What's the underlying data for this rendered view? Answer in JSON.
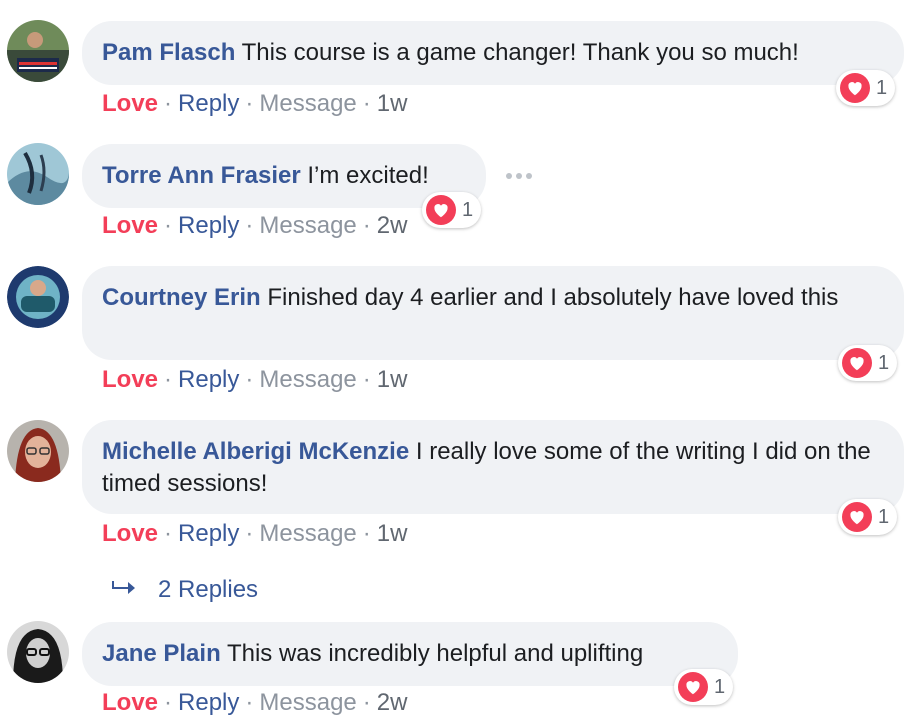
{
  "comments": [
    {
      "author": "Pam Flasch",
      "text": "This course is a game changer! Thank you so much!",
      "love": "Love",
      "reply": "Reply",
      "message": "Message",
      "age": "1w",
      "reaction_count": "1"
    },
    {
      "author": "Torre Ann Frasier",
      "text": "I’m excited!",
      "love": "Love",
      "reply": "Reply",
      "message": "Message",
      "age": "2w",
      "reaction_count": "1"
    },
    {
      "author": "Courtney Erin",
      "text": "Finished day 4 earlier and I absolutely have loved this",
      "love": "Love",
      "reply": "Reply",
      "message": "Message",
      "age": "1w",
      "reaction_count": "1"
    },
    {
      "author": "Michelle Alberigi McKenzie",
      "text": "I really love some of the writing I did on the timed sessions!",
      "love": "Love",
      "reply": "Reply",
      "message": "Message",
      "age": "1w",
      "reaction_count": "1"
    },
    {
      "author": "Jane Plain",
      "text": "This was incredibly helpful and uplifting",
      "love": "Love",
      "reply": "Reply",
      "message": "Message",
      "age": "2w",
      "reaction_count": "1"
    }
  ],
  "replies_link": {
    "label": "2 Replies",
    "icon": "reply-arrow-icon"
  },
  "colors": {
    "author": "#385898",
    "love": "#f33e58",
    "bubble": "#f0f2f5",
    "muted": "#8d949e"
  }
}
